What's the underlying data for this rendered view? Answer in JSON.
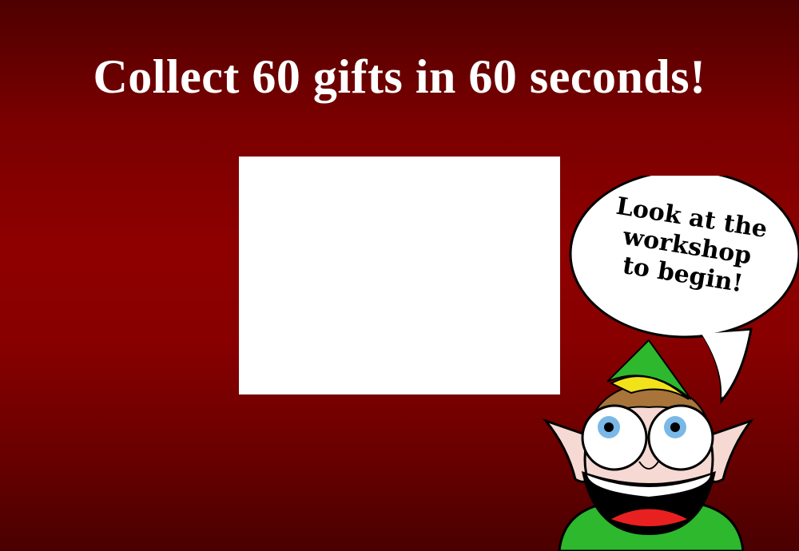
{
  "title": "Collect 60 gifts in 60 seconds!",
  "speech_bubble": {
    "lines": [
      "Look at the",
      "workshop",
      "to begin!"
    ]
  },
  "colors": {
    "background": "#8e0000",
    "title": "#ffffff",
    "game_area": "#ffffff",
    "elf_green": "#2db82d"
  },
  "icons": {
    "mascot": "elf-icon",
    "bubble": "speech-bubble-icon"
  }
}
